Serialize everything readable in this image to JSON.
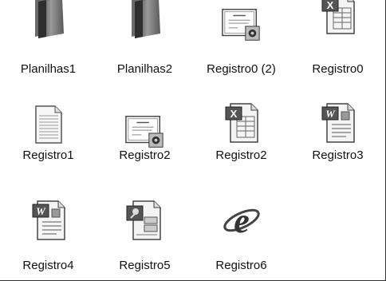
{
  "files": [
    {
      "label": "Planilhas1",
      "icon": "folder-icon"
    },
    {
      "label": "Planilhas2",
      "icon": "folder-icon"
    },
    {
      "label": "Registro0 (2)",
      "icon": "certificate-icon"
    },
    {
      "label": "Registro0",
      "icon": "excel-document-icon"
    },
    {
      "label": "Registro1",
      "icon": "text-document-icon"
    },
    {
      "label": "Registro2",
      "icon": "certificate-icon"
    },
    {
      "label": "Registro2",
      "icon": "excel-document-icon"
    },
    {
      "label": "Registro3",
      "icon": "word-document-icon"
    },
    {
      "label": "Registro4",
      "icon": "word-document-icon"
    },
    {
      "label": "Registro5",
      "icon": "publisher-document-icon"
    },
    {
      "label": "Registro6",
      "icon": "internet-explorer-icon"
    }
  ]
}
